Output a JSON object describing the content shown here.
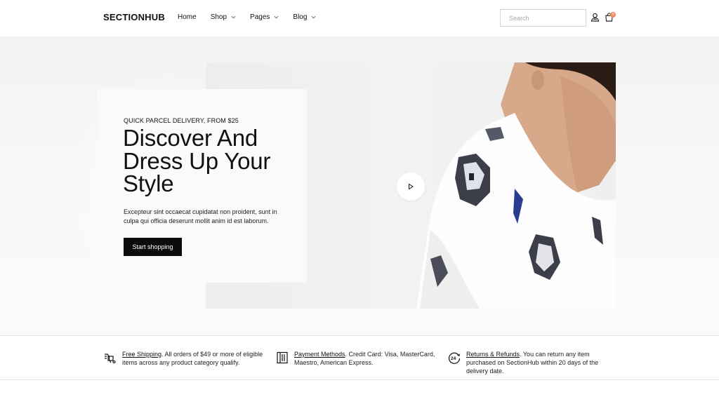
{
  "header": {
    "logo": "SECTIONHUB",
    "nav": [
      {
        "label": "Home",
        "has_dropdown": false
      },
      {
        "label": "Shop",
        "has_dropdown": true
      },
      {
        "label": "Pages",
        "has_dropdown": true
      },
      {
        "label": "Blog",
        "has_dropdown": true
      }
    ],
    "search_placeholder": "Search",
    "cart_count": "0",
    "icons": [
      "user-icon",
      "shopping-bag-icon"
    ]
  },
  "hero": {
    "eyebrow": "QUICK PARCEL DELIVERY, FROM $25",
    "headline": "Discover And Dress Up Your Style",
    "body": "Excepteur sint occaecat cupidatat non proident, sunt in culpa qui officia deserunt mollit anim id est laborum.",
    "cta": "Start shopping",
    "play_icon": "play-icon"
  },
  "features": [
    {
      "icon": "fast-delivery-icon",
      "link": "Free Shipping",
      "text": ". All orders of $49 or more of eligible items across any product category qualify."
    },
    {
      "icon": "payment-card-icon",
      "link": "Payment Methods",
      "text": ". Credit Card: Visa, MasterCard, Maestro, American Express."
    },
    {
      "icon": "24h-returns-icon",
      "link": "Returns & Refunds",
      "text": ". You can return any item purchased on SectionHub within 20 days of the delivery date."
    }
  ],
  "colors": {
    "accent_badge": "#f08a5d",
    "button_bg": "#0b0b0b",
    "hero_bg": "#f3f3f3"
  }
}
